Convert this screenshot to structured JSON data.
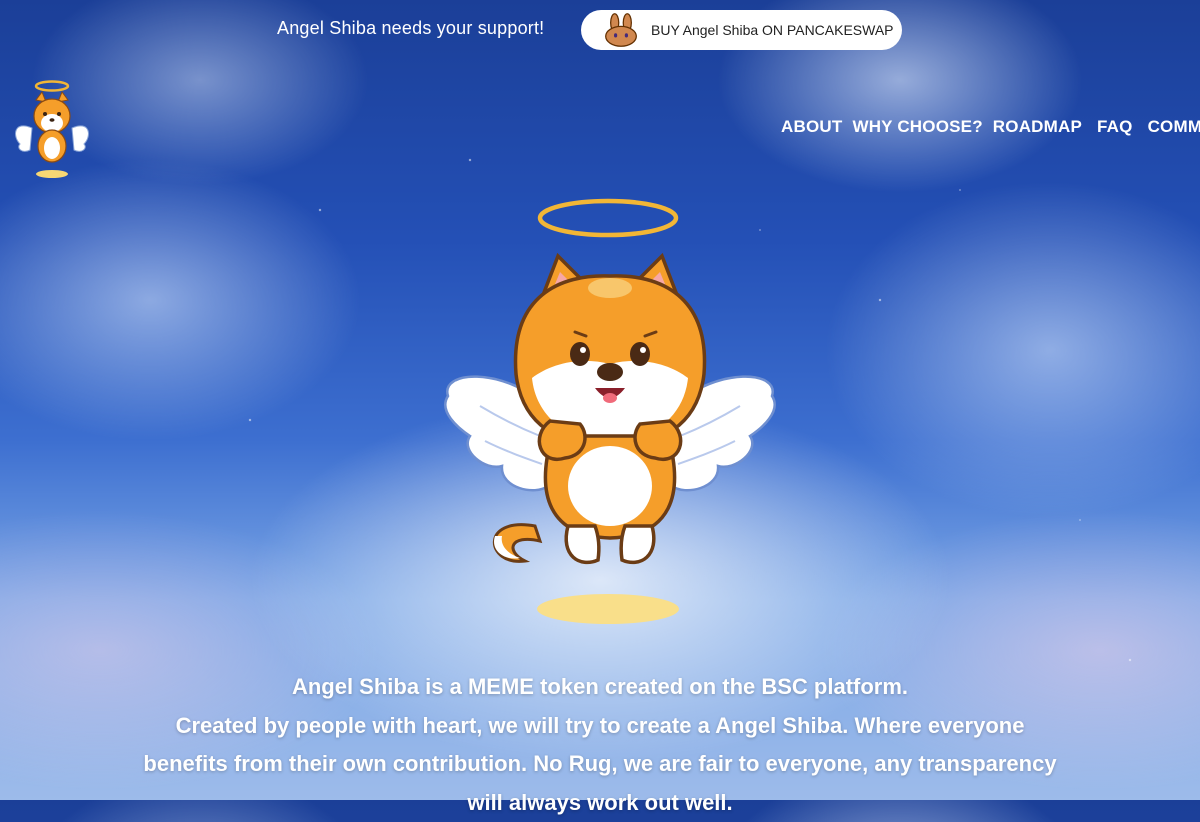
{
  "banner": {
    "support_text": "Angel Shiba needs your support!",
    "buy_label": "BUY Angel Shiba ON PANCAKESWAP",
    "buy_icon": "pancakeswap-bunny-icon"
  },
  "header": {
    "logo_icon": "angel-shiba-logo",
    "nav": [
      "ABOUT",
      "WHY CHOOSE?",
      "ROADMAP",
      "FAQ",
      "COMMUNIT"
    ]
  },
  "hero": {
    "mascot_icon": "angel-shiba-mascot"
  },
  "description": {
    "line1": "Angel Shiba is a MEME token created on the BSC platform.",
    "line2": "Created by people with heart, we will try to create a Angel Shiba. Where everyone benefits from their own contribution. No Rug, we are fair to everyone, any transparency will always work out well."
  },
  "colors": {
    "sky_top": "#1b3f98",
    "sky_bottom": "#9dbbea",
    "halo_gold": "#f2b636",
    "shiba_orange": "#f59e2a",
    "text_white": "#ffffff"
  }
}
